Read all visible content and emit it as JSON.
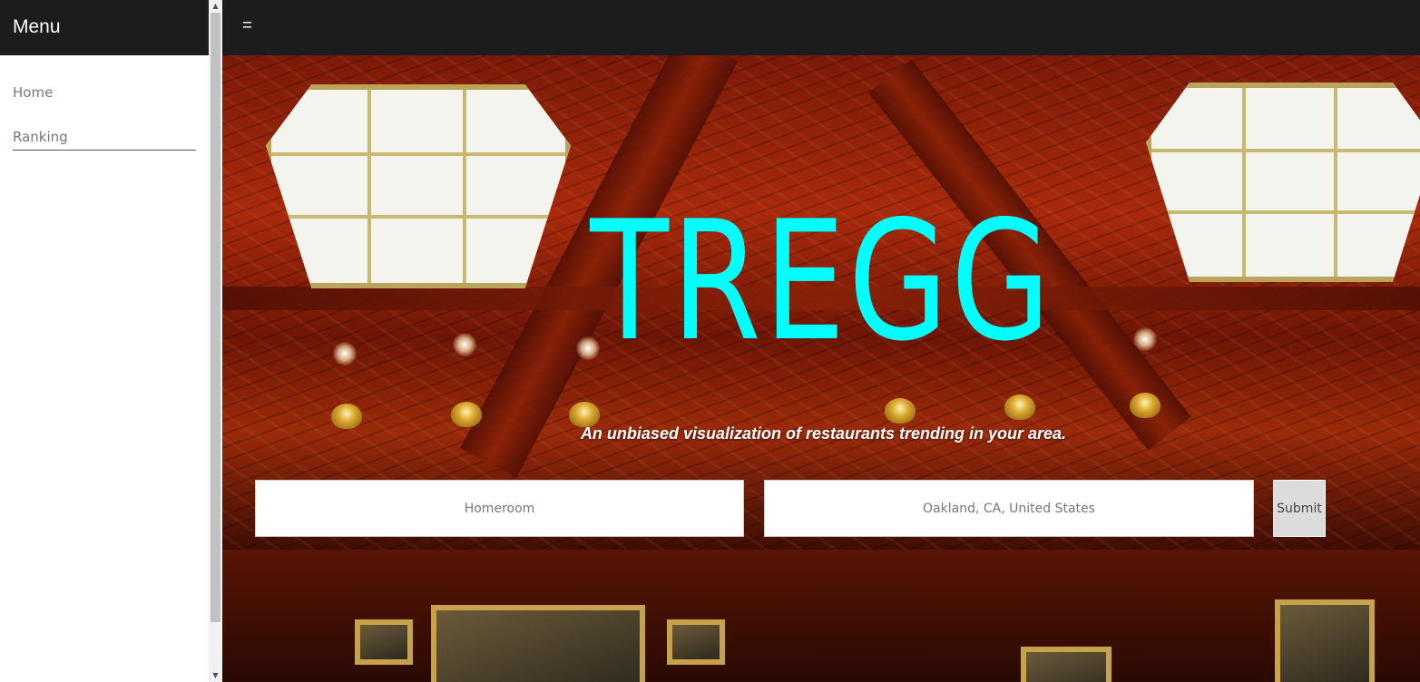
{
  "sidebar": {
    "title": "Menu",
    "items": [
      {
        "label": "Home"
      },
      {
        "label": "Ranking"
      }
    ]
  },
  "topbar": {
    "toggle_label": "="
  },
  "hero": {
    "brand": "TREGG",
    "tagline": "An unbiased visualization of restaurants trending in your area."
  },
  "search": {
    "restaurant_placeholder": "Homeroom",
    "location_placeholder": "Oakland, CA, United States",
    "submit_label": "Submit"
  },
  "colors": {
    "brand": "#00ffff",
    "header_bg": "#1c1c1e",
    "sidebar_text": "#777777"
  }
}
